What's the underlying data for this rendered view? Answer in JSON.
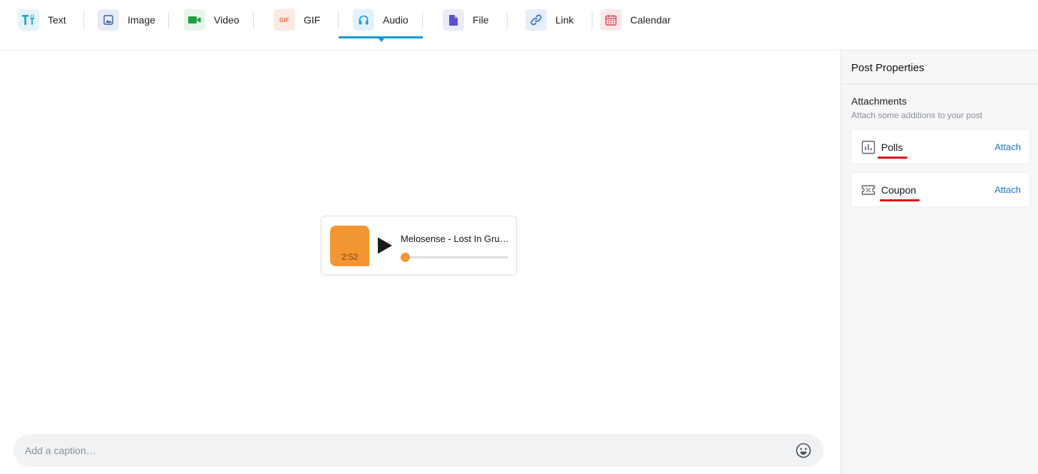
{
  "toolbar": {
    "tabs": [
      {
        "id": "text",
        "label": "Text",
        "icon": "text-format-icon",
        "color": "#1aa0c8",
        "bg": "#e4f4f9"
      },
      {
        "id": "image",
        "label": "Image",
        "icon": "image-icon",
        "color": "#3a5ba8",
        "bg": "#e8ecf7"
      },
      {
        "id": "video",
        "label": "Video",
        "icon": "video-camera-icon",
        "color": "#1e9e3e",
        "bg": "#e6f6ea"
      },
      {
        "id": "gif",
        "label": "GIF",
        "icon": "gif-icon",
        "color": "#e0623a",
        "bg": "#fbe9e4",
        "icon_text": "GIF"
      },
      {
        "id": "audio",
        "label": "Audio",
        "icon": "headphones-icon",
        "color": "#119bd6",
        "bg": "#e2f3fb",
        "active": true
      },
      {
        "id": "file",
        "label": "File",
        "icon": "file-icon",
        "color": "#5b50d6",
        "bg": "#ecebfb"
      },
      {
        "id": "link",
        "label": "Link",
        "icon": "link-icon",
        "color": "#2f6fd1",
        "bg": "#e6eefb"
      },
      {
        "id": "calendar",
        "label": "Calendar",
        "icon": "calendar-icon",
        "color": "#e0404f",
        "bg": "#fbe8ea"
      }
    ]
  },
  "player": {
    "title": "Melosense - Lost In Gru…",
    "duration": "2:52",
    "progress": 0.0,
    "accent": "#f39530"
  },
  "caption": {
    "placeholder": "Add a caption…",
    "value": ""
  },
  "panel": {
    "title": "Post Properties",
    "section_title": "Attachments",
    "section_subtitle": "Attach some additions to your post",
    "items": [
      {
        "label": "Polls",
        "icon": "poll-chart-icon",
        "action": "Attach"
      },
      {
        "label": "Coupon",
        "icon": "coupon-ticket-icon",
        "action": "Attach"
      }
    ]
  }
}
